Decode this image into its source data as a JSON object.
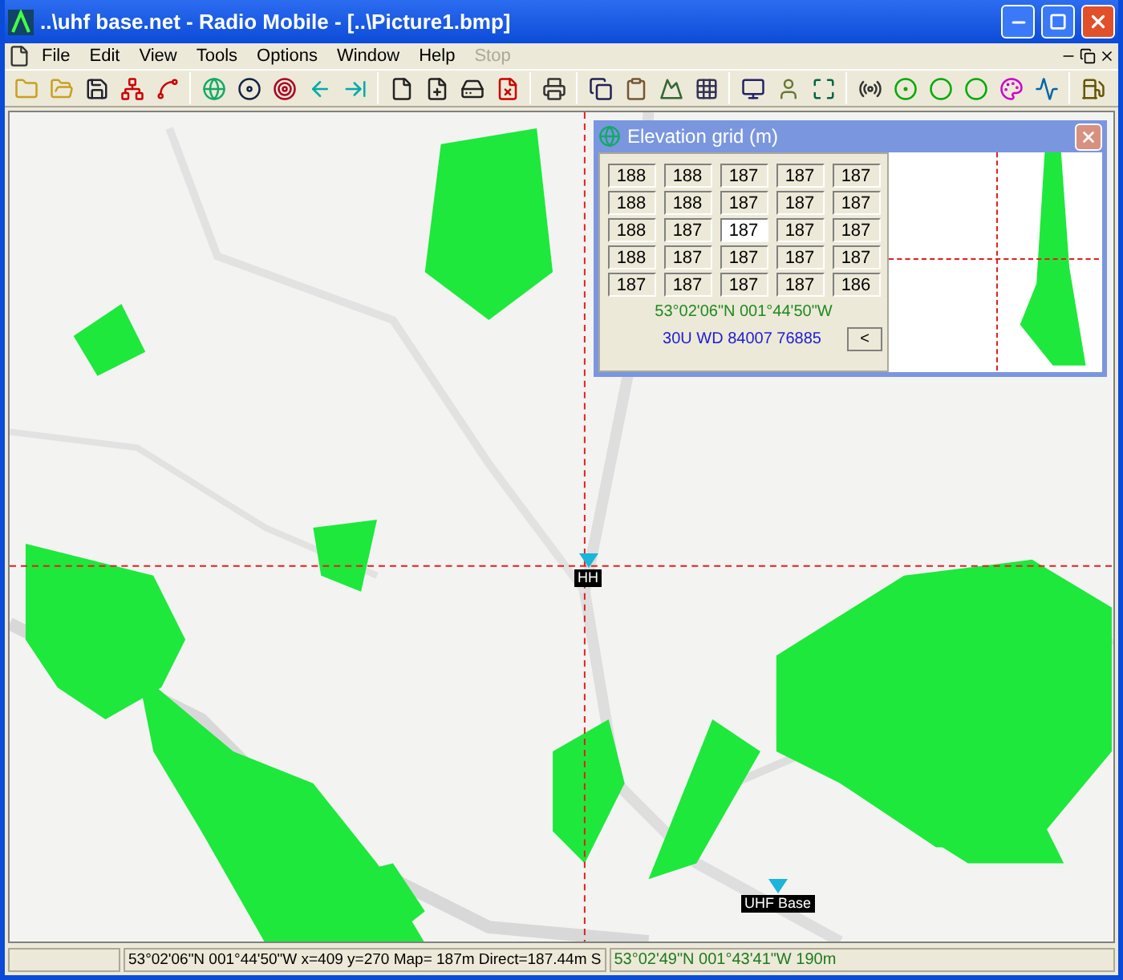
{
  "window": {
    "title": "..\\uhf base.net - Radio Mobile - [..\\Picture1.bmp]"
  },
  "menu": [
    {
      "label": "File",
      "disabled": false
    },
    {
      "label": "Edit",
      "disabled": false
    },
    {
      "label": "View",
      "disabled": false
    },
    {
      "label": "Tools",
      "disabled": false
    },
    {
      "label": "Options",
      "disabled": false
    },
    {
      "label": "Window",
      "disabled": false
    },
    {
      "label": "Help",
      "disabled": false
    },
    {
      "label": "Stop",
      "disabled": true
    }
  ],
  "map": {
    "units": [
      {
        "label": "HH"
      },
      {
        "label": "UHF Base"
      }
    ]
  },
  "elevation_grid": {
    "title": "Elevation grid (m)",
    "rows": [
      [
        {
          "value": "188",
          "selected": false
        },
        {
          "value": "188",
          "selected": false
        },
        {
          "value": "187",
          "selected": false
        },
        {
          "value": "187",
          "selected": false
        },
        {
          "value": "187",
          "selected": false
        }
      ],
      [
        {
          "value": "188",
          "selected": false
        },
        {
          "value": "188",
          "selected": false
        },
        {
          "value": "187",
          "selected": false
        },
        {
          "value": "187",
          "selected": false
        },
        {
          "value": "187",
          "selected": false
        }
      ],
      [
        {
          "value": "188",
          "selected": false
        },
        {
          "value": "187",
          "selected": false
        },
        {
          "value": "187",
          "selected": true
        },
        {
          "value": "187",
          "selected": false
        },
        {
          "value": "187",
          "selected": false
        }
      ],
      [
        {
          "value": "188",
          "selected": false
        },
        {
          "value": "187",
          "selected": false
        },
        {
          "value": "187",
          "selected": false
        },
        {
          "value": "187",
          "selected": false
        },
        {
          "value": "187",
          "selected": false
        }
      ],
      [
        {
          "value": "187",
          "selected": false
        },
        {
          "value": "187",
          "selected": false
        },
        {
          "value": "187",
          "selected": false
        },
        {
          "value": "187",
          "selected": false
        },
        {
          "value": "186",
          "selected": false
        }
      ]
    ],
    "latlon": "53°02'06\"N  001°44'50\"W",
    "utm": "30U WD 84007 76885",
    "collapse_button": "<"
  },
  "status_bar": {
    "panel_2": "53°02'06\"N  001°44'50\"W  x=409 y=270 Map= 187m Direct=187.44m S",
    "panel_3": "53°02'49\"N 001°43'41\"W 190m"
  }
}
